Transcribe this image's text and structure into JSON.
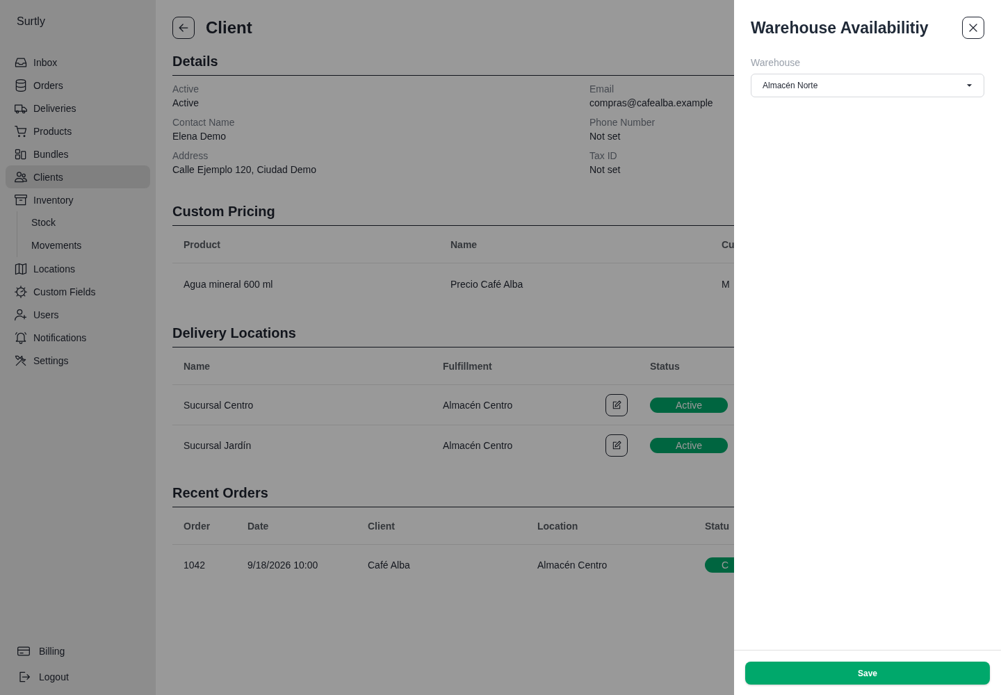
{
  "sidebar": {
    "brand": "Surtly",
    "items": [
      {
        "label": "Inbox",
        "selected": false
      },
      {
        "label": "Orders",
        "selected": false
      },
      {
        "label": "Deliveries",
        "selected": false
      },
      {
        "label": "Products",
        "selected": false
      },
      {
        "label": "Bundles",
        "selected": false
      },
      {
        "label": "Clients",
        "selected": true
      },
      {
        "label": "Inventory",
        "selected": false,
        "children": [
          {
            "label": "Stock",
            "selected": false
          },
          {
            "label": "Movements",
            "selected": false
          }
        ]
      },
      {
        "label": "Locations",
        "selected": false
      },
      {
        "label": "Custom Fields",
        "selected": false
      },
      {
        "label": "Users",
        "selected": false
      },
      {
        "label": "Notifications",
        "selected": false
      },
      {
        "label": "Settings",
        "selected": false
      }
    ],
    "bottom_items": [
      {
        "label": "Billing"
      },
      {
        "label": "Logout"
      }
    ]
  },
  "page": {
    "title": "Client",
    "details": {
      "heading": "Details",
      "fields": [
        {
          "label": "Active",
          "value": "Active"
        },
        {
          "label": "Email",
          "value": "compras@cafealba.example"
        },
        {
          "label": "Contact Name",
          "value": "Elena Demo"
        },
        {
          "label": "Phone Number",
          "value": "Not set"
        },
        {
          "label": "Address",
          "value": "Calle Ejemplo 120, Ciudad Demo"
        },
        {
          "label": "Tax ID",
          "value": "Not set"
        }
      ]
    },
    "custom_pricing": {
      "heading": "Custom Pricing",
      "columns": [
        "Product",
        "Name",
        "Cu"
      ],
      "rows": [
        [
          "Agua mineral 600 ml",
          "Precio Café Alba",
          "M"
        ]
      ]
    },
    "delivery_locations": {
      "heading": "Delivery Locations",
      "columns": [
        "Name",
        "Fulfillment",
        "Status"
      ],
      "rows": [
        {
          "name": "Sucursal Centro",
          "fulfillment": "Almacén Centro",
          "status": "Active"
        },
        {
          "name": "Sucursal Jardín",
          "fulfillment": "Almacén Centro",
          "status": "Active"
        }
      ]
    },
    "recent_orders": {
      "heading": "Recent Orders",
      "columns": [
        "Order",
        "Date",
        "Client",
        "Location",
        "Statu"
      ],
      "rows": [
        {
          "order": "1042",
          "date": "9/18/2026 10:00",
          "client": "Café Alba",
          "location": "Almacén Centro",
          "status": "C"
        }
      ]
    }
  },
  "drawer": {
    "title": "Warehouse Availabilitiy",
    "field_label": "Warehouse",
    "field_value": "Almacén Norte",
    "save": "Save"
  }
}
